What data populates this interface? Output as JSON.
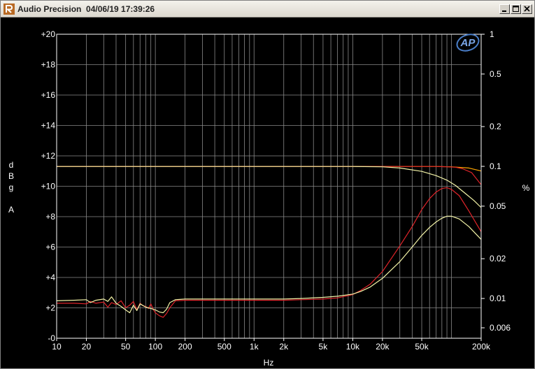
{
  "window": {
    "title": "Audio Precision  04/06/19 17:39:26"
  },
  "icons": {
    "app": "audio-precision-icon",
    "min": "minimize-icon",
    "max": "maximize-icon",
    "close": "close-icon",
    "logo": "ap-logo"
  },
  "logo_text": "AP",
  "chart_data": {
    "type": "line",
    "x_scale": "log",
    "x_range": [
      10,
      200000
    ],
    "xlabel": "Hz",
    "x_ticks": [
      {
        "v": 10,
        "label": "10"
      },
      {
        "v": 20,
        "label": "20"
      },
      {
        "v": 50,
        "label": "50"
      },
      {
        "v": 100,
        "label": "100"
      },
      {
        "v": 200,
        "label": "200"
      },
      {
        "v": 500,
        "label": "500"
      },
      {
        "v": 1000,
        "label": "1k"
      },
      {
        "v": 2000,
        "label": "2k"
      },
      {
        "v": 5000,
        "label": "5k"
      },
      {
        "v": 10000,
        "label": "10k"
      },
      {
        "v": 20000,
        "label": "20k"
      },
      {
        "v": 50000,
        "label": "50k"
      },
      {
        "v": 200000,
        "label": "200k"
      }
    ],
    "y_left": {
      "label": [
        "d",
        "B",
        "g",
        "",
        "A"
      ],
      "range": [
        0,
        20
      ],
      "scale": "linear",
      "ticks": [
        {
          "v": 0,
          "label": "-0"
        },
        {
          "v": 2,
          "label": "+2"
        },
        {
          "v": 4,
          "label": "+4"
        },
        {
          "v": 6,
          "label": "+6"
        },
        {
          "v": 8,
          "label": "+8"
        },
        {
          "v": 10,
          "label": "+10"
        },
        {
          "v": 12,
          "label": "+12"
        },
        {
          "v": 14,
          "label": "+14"
        },
        {
          "v": 16,
          "label": "+16"
        },
        {
          "v": 18,
          "label": "+18"
        },
        {
          "v": 20,
          "label": "+20"
        }
      ]
    },
    "y_right": {
      "label": "%",
      "range": [
        0.005,
        1
      ],
      "scale": "log",
      "ticks": [
        {
          "v": 1,
          "label": "1"
        },
        {
          "v": 0.5,
          "label": "0.5"
        },
        {
          "v": 0.2,
          "label": "0.2"
        },
        {
          "v": 0.1,
          "label": "0.1"
        },
        {
          "v": 0.05,
          "label": "0.05"
        },
        {
          "v": 0.02,
          "label": "0.02"
        },
        {
          "v": 0.01,
          "label": "0.01"
        },
        {
          "v": 0.006,
          "label": "0.006"
        }
      ]
    },
    "grid": true,
    "colors": {
      "red": "#e0242a",
      "yellow": "#f4f4a8",
      "orange": "#ffa500",
      "grid": "#8a8a8a",
      "frame": "#ffffff",
      "background": "#000000"
    },
    "series": [
      {
        "color": "orange",
        "axis": "left",
        "x": [
          10,
          1000,
          10000,
          20000,
          40000,
          70000,
          100000,
          150000,
          200000
        ],
        "y": [
          11.3,
          11.3,
          11.3,
          11.3,
          11.3,
          11.3,
          11.28,
          11.2,
          11.0
        ]
      },
      {
        "color": "red",
        "axis": "left",
        "x": [
          10,
          1000,
          10000,
          20000,
          30000,
          50000,
          70000,
          90000,
          110000,
          130000,
          160000,
          200000
        ],
        "y": [
          11.3,
          11.3,
          11.3,
          11.3,
          11.3,
          11.3,
          11.3,
          11.28,
          11.25,
          11.15,
          10.9,
          10.1
        ]
      },
      {
        "color": "yellow",
        "axis": "left",
        "x": [
          10,
          1000,
          10000,
          20000,
          30000,
          50000,
          70000,
          90000,
          110000,
          140000,
          170000,
          200000
        ],
        "y": [
          11.3,
          11.3,
          11.3,
          11.28,
          11.2,
          10.98,
          10.7,
          10.4,
          10.05,
          9.5,
          9.05,
          8.6
        ]
      },
      {
        "color": "red",
        "axis": "right",
        "x": [
          10,
          15,
          20,
          22,
          25,
          30,
          33,
          36,
          40,
          45,
          50,
          55,
          60,
          65,
          70,
          75,
          80,
          85,
          90,
          95,
          100,
          110,
          120,
          130,
          140,
          160,
          200,
          300,
          500,
          1000,
          2000,
          3000,
          5000,
          7000,
          10000,
          12000,
          15000,
          20000,
          30000,
          40000,
          50000,
          60000,
          70000,
          80000,
          90000,
          100000,
          120000,
          150000,
          200000
        ],
        "y": [
          0.0092,
          0.0092,
          0.0091,
          0.0095,
          0.0092,
          0.0094,
          0.0086,
          0.0093,
          0.009,
          0.0096,
          0.0085,
          0.0089,
          0.0095,
          0.0082,
          0.0092,
          0.0088,
          0.0087,
          0.0084,
          0.0091,
          0.0083,
          0.0078,
          0.0074,
          0.0072,
          0.0077,
          0.0085,
          0.0096,
          0.0097,
          0.0097,
          0.0097,
          0.0097,
          0.0097,
          0.0098,
          0.0099,
          0.0101,
          0.0107,
          0.0115,
          0.0128,
          0.016,
          0.025,
          0.035,
          0.047,
          0.057,
          0.064,
          0.068,
          0.069,
          0.067,
          0.06,
          0.046,
          0.032
        ]
      },
      {
        "color": "yellow",
        "axis": "right",
        "x": [
          10,
          15,
          20,
          22,
          25,
          30,
          33,
          36,
          40,
          45,
          50,
          55,
          60,
          65,
          70,
          80,
          90,
          100,
          110,
          120,
          130,
          140,
          160,
          200,
          300,
          500,
          1000,
          2000,
          3000,
          5000,
          7000,
          10000,
          12000,
          15000,
          20000,
          30000,
          40000,
          50000,
          60000,
          70000,
          80000,
          90000,
          100000,
          120000,
          150000,
          200000
        ],
        "y": [
          0.0096,
          0.0097,
          0.0098,
          0.0093,
          0.0097,
          0.0099,
          0.0095,
          0.0103,
          0.0092,
          0.0087,
          0.0082,
          0.0078,
          0.0089,
          0.0081,
          0.0091,
          0.0086,
          0.0084,
          0.0082,
          0.0079,
          0.0078,
          0.0083,
          0.0093,
          0.0098,
          0.0099,
          0.0099,
          0.0099,
          0.0099,
          0.0099,
          0.01,
          0.0102,
          0.0104,
          0.0108,
          0.0113,
          0.0122,
          0.0142,
          0.019,
          0.0245,
          0.03,
          0.0345,
          0.038,
          0.0405,
          0.042,
          0.042,
          0.04,
          0.035,
          0.028
        ]
      }
    ]
  }
}
